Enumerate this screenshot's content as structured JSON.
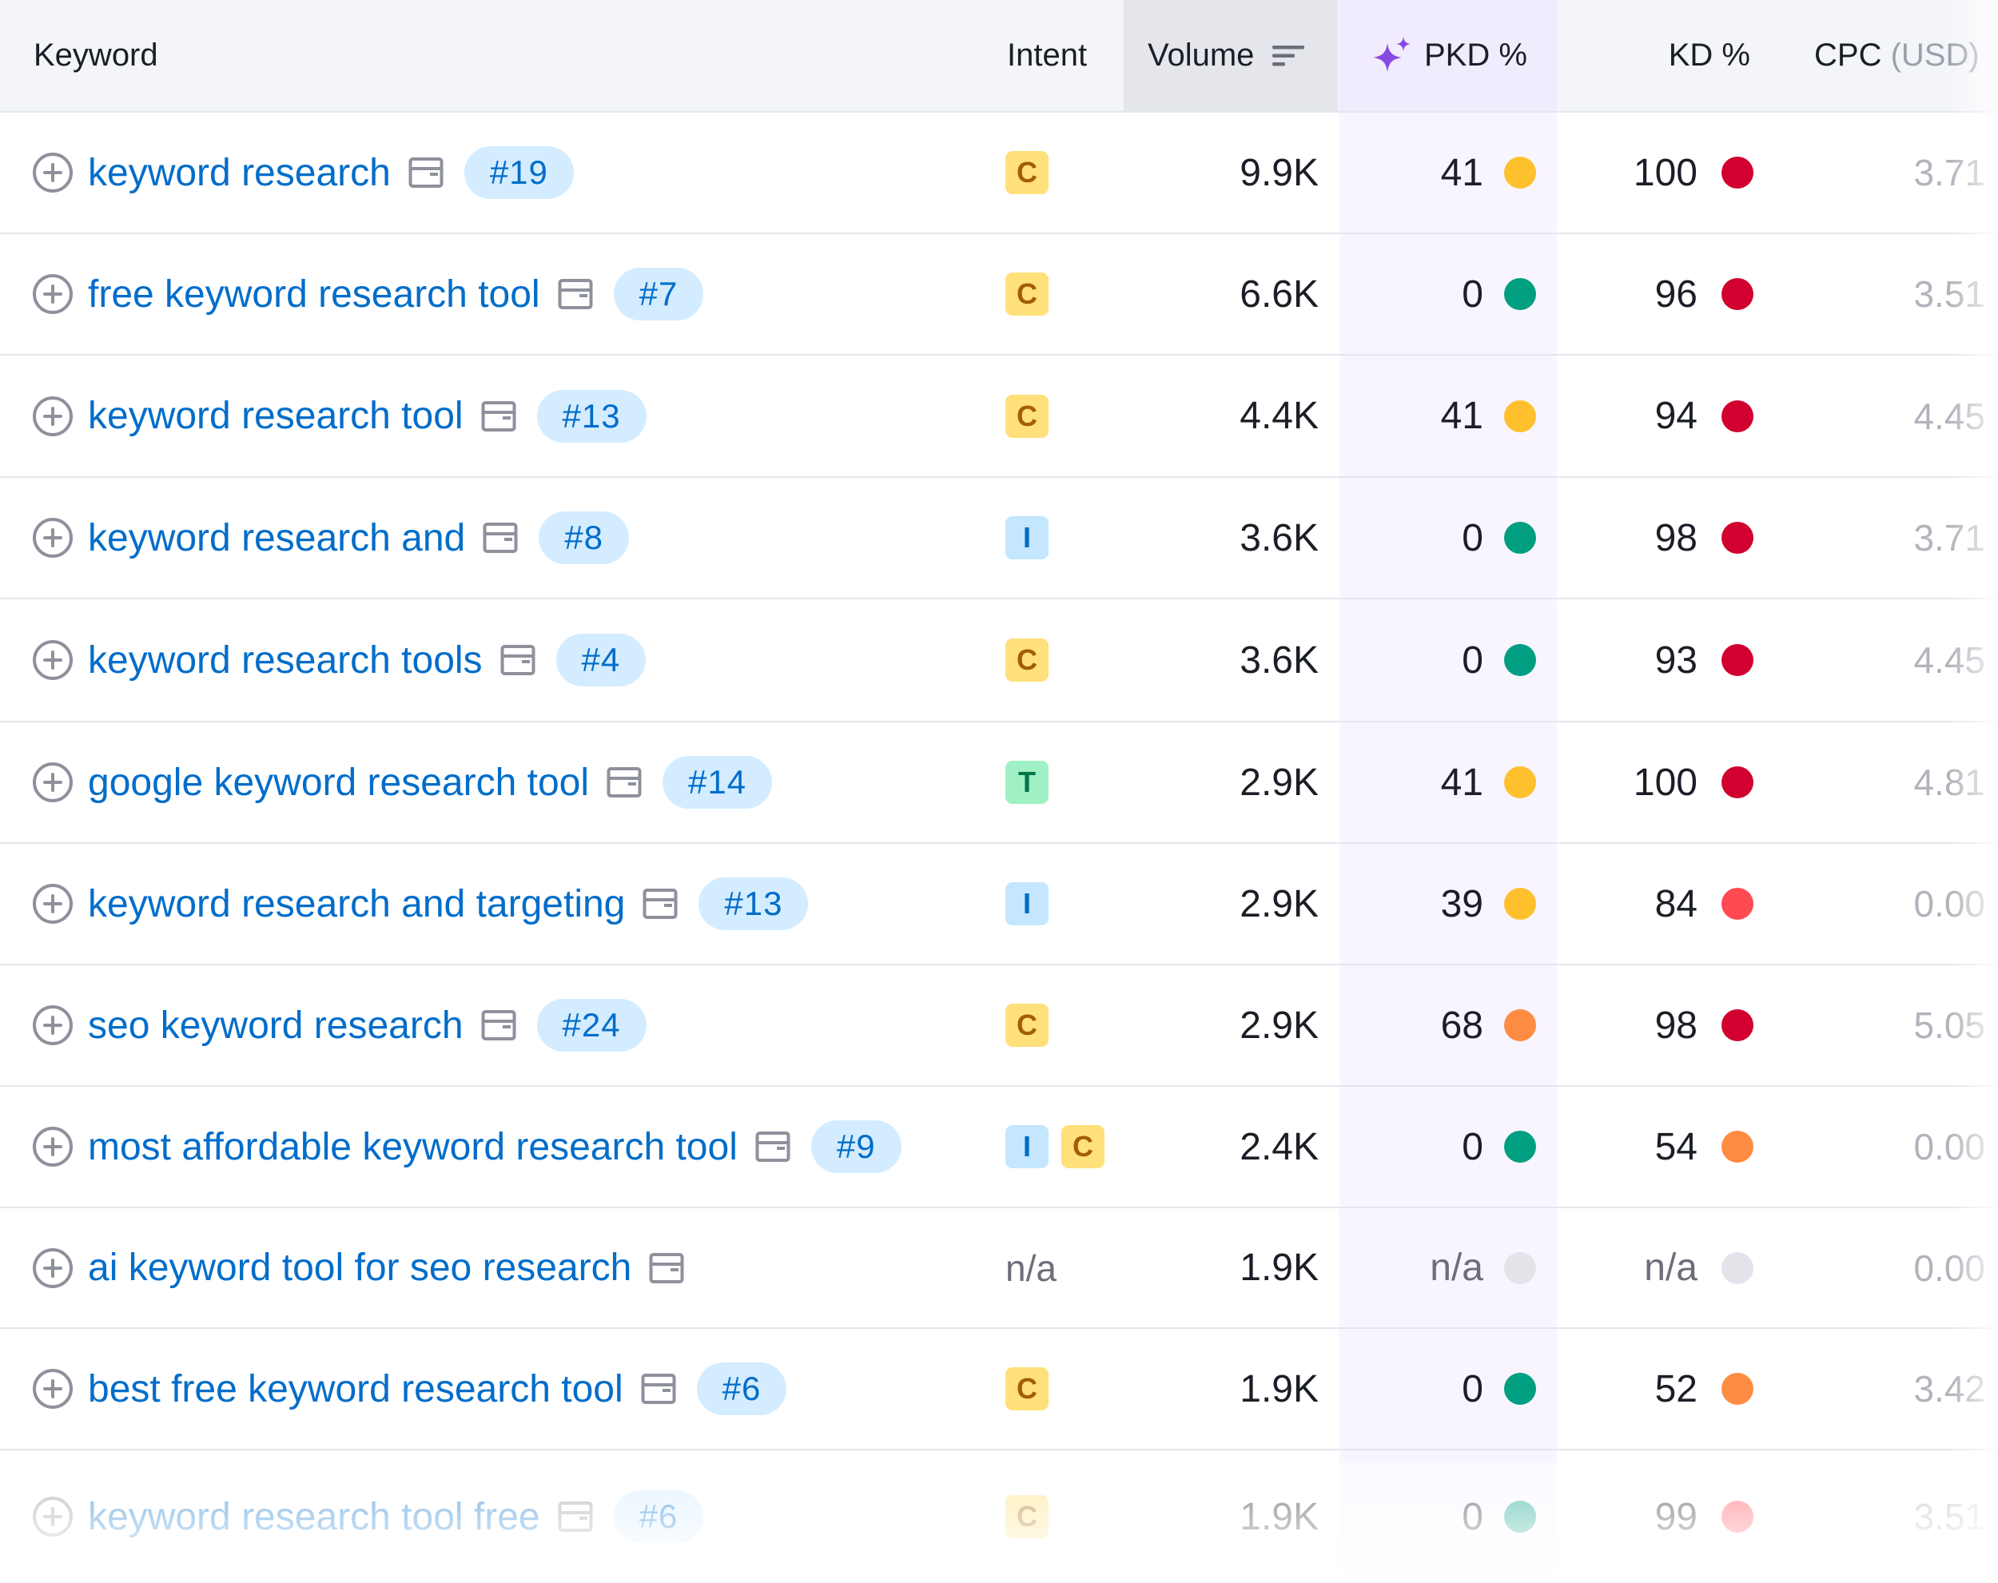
{
  "columns": {
    "keyword": "Keyword",
    "intent": "Intent",
    "volume": "Volume",
    "pkd": "PKD %",
    "kd": "KD %",
    "cpc_main": "CPC",
    "cpc_unit": "(USD)"
  },
  "colors": {
    "link": "#006dca",
    "intent_commercial": "#ffe07a",
    "intent_informational": "#c4e6ff",
    "intent_transactional": "#9ff0c4",
    "dot_green": "#009f81",
    "dot_yellow": "#ffc02e",
    "dot_orange": "#ff8c43",
    "dot_light_red": "#ff4953",
    "dot_red": "#d1002f",
    "dot_na": "#e3e4ea"
  },
  "rows": [
    {
      "keyword": "keyword research",
      "position": "#19",
      "intent": [
        "C"
      ],
      "volume": "9.9K",
      "pkd": "41",
      "pkd_level": "yellow",
      "kd": "100",
      "kd_level": "red",
      "cpc": "3.71"
    },
    {
      "keyword": "free keyword research tool",
      "position": "#7",
      "intent": [
        "C"
      ],
      "volume": "6.6K",
      "pkd": "0",
      "pkd_level": "green",
      "kd": "96",
      "kd_level": "red",
      "cpc": "3.51"
    },
    {
      "keyword": "keyword research tool",
      "position": "#13",
      "intent": [
        "C"
      ],
      "volume": "4.4K",
      "pkd": "41",
      "pkd_level": "yellow",
      "kd": "94",
      "kd_level": "red",
      "cpc": "4.45"
    },
    {
      "keyword": "keyword research and",
      "position": "#8",
      "intent": [
        "I"
      ],
      "volume": "3.6K",
      "pkd": "0",
      "pkd_level": "green",
      "kd": "98",
      "kd_level": "red",
      "cpc": "3.71"
    },
    {
      "keyword": "keyword research tools",
      "position": "#4",
      "intent": [
        "C"
      ],
      "volume": "3.6K",
      "pkd": "0",
      "pkd_level": "green",
      "kd": "93",
      "kd_level": "red",
      "cpc": "4.45"
    },
    {
      "keyword": "google keyword research tool",
      "position": "#14",
      "intent": [
        "T"
      ],
      "volume": "2.9K",
      "pkd": "41",
      "pkd_level": "yellow",
      "kd": "100",
      "kd_level": "red",
      "cpc": "4.81"
    },
    {
      "keyword": "keyword research and targeting",
      "position": "#13",
      "intent": [
        "I"
      ],
      "volume": "2.9K",
      "pkd": "39",
      "pkd_level": "yellow",
      "kd": "84",
      "kd_level": "light_red",
      "cpc": "0.00"
    },
    {
      "keyword": "seo keyword research",
      "position": "#24",
      "intent": [
        "C"
      ],
      "volume": "2.9K",
      "pkd": "68",
      "pkd_level": "orange",
      "kd": "98",
      "kd_level": "red",
      "cpc": "5.05"
    },
    {
      "keyword": "most affordable keyword research tool",
      "position": "#9",
      "intent": [
        "I",
        "C"
      ],
      "volume": "2.4K",
      "pkd": "0",
      "pkd_level": "green",
      "kd": "54",
      "kd_level": "orange",
      "cpc": "0.00"
    },
    {
      "keyword": "ai keyword tool for seo research",
      "position": "",
      "intent": [],
      "intent_na": "n/a",
      "volume": "1.9K",
      "pkd": "n/a",
      "pkd_level": "na",
      "kd": "n/a",
      "kd_level": "na",
      "cpc": "0.00"
    },
    {
      "keyword": "best free keyword research tool",
      "position": "#6",
      "intent": [
        "C"
      ],
      "volume": "1.9K",
      "pkd": "0",
      "pkd_level": "green",
      "kd": "52",
      "kd_level": "orange",
      "cpc": "3.42"
    },
    {
      "keyword": "keyword research tool free",
      "position": "#6",
      "intent": [
        "C"
      ],
      "volume": "1.9K",
      "pkd": "0",
      "pkd_level": "green",
      "kd": "99",
      "kd_level": "light_red",
      "cpc": "3.51"
    }
  ]
}
